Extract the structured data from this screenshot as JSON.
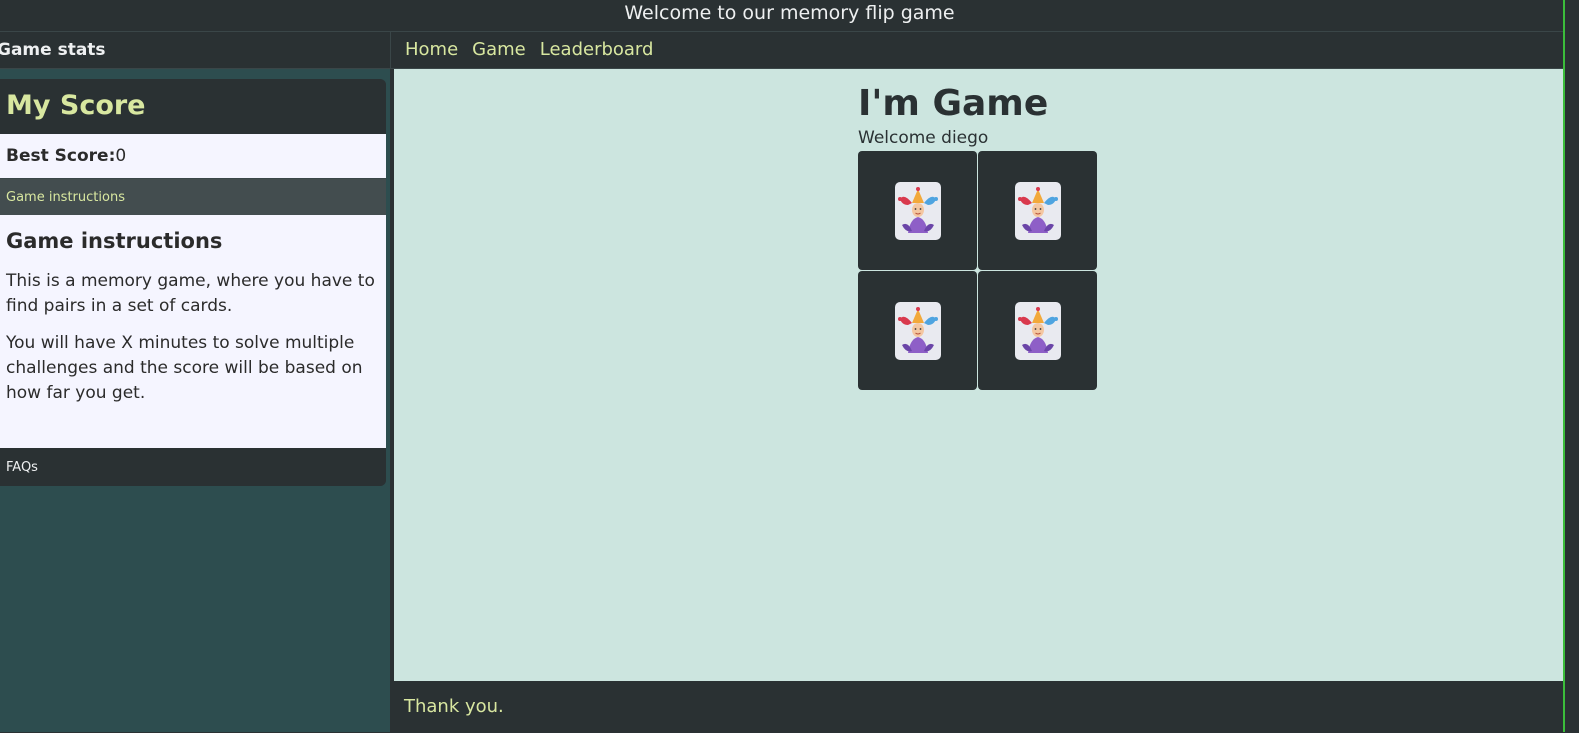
{
  "window": {
    "title": "Welcome to our memory flip game"
  },
  "sidebar": {
    "header": "Game stats",
    "score": {
      "title": "My Score",
      "best_label": "Best Score:",
      "best_value": "0"
    },
    "instructions": {
      "tab_label": "Game instructions",
      "heading": "Game instructions",
      "paragraphs": [
        "This is a memory game, where you have to find pairs in a set of cards.",
        "You will have X minutes to solve multiple challenges and the score will be based on how far you get."
      ]
    },
    "faq_label": "FAQs"
  },
  "nav": {
    "items": [
      {
        "label": "Home"
      },
      {
        "label": "Game"
      },
      {
        "label": "Leaderboard"
      }
    ]
  },
  "game": {
    "title": "I'm Game",
    "welcome": "Welcome diego",
    "cards": [
      {
        "icon": "joker-card-icon"
      },
      {
        "icon": "joker-card-icon"
      },
      {
        "icon": "joker-card-icon"
      },
      {
        "icon": "joker-card-icon"
      }
    ]
  },
  "footer": {
    "text": "Thank you."
  },
  "colors": {
    "dark": "#2a3133",
    "sidebar_bg": "#2d4d4f",
    "main_bg": "#cce5df",
    "accent": "#d8e7a0",
    "panel_light": "#f5f5ff"
  }
}
